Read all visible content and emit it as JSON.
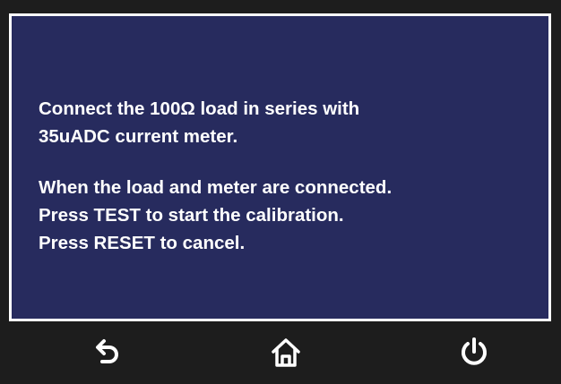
{
  "message": {
    "line1": "Connect the 100Ω load in series with",
    "line2": "35uADC current meter.",
    "line3": "When the load and meter are connected.",
    "line4": "Press TEST to start the calibration.",
    "line5": "Press RESET to cancel."
  },
  "nav": {
    "buttons": [
      {
        "icon": "back-arrow-icon"
      },
      {
        "icon": "home-icon"
      },
      {
        "icon": "power-icon"
      }
    ]
  },
  "colors": {
    "panel_background": "#272b5e",
    "panel_border": "#ffffff",
    "frame_background": "#1d1d1d",
    "text": "#ffffff"
  }
}
